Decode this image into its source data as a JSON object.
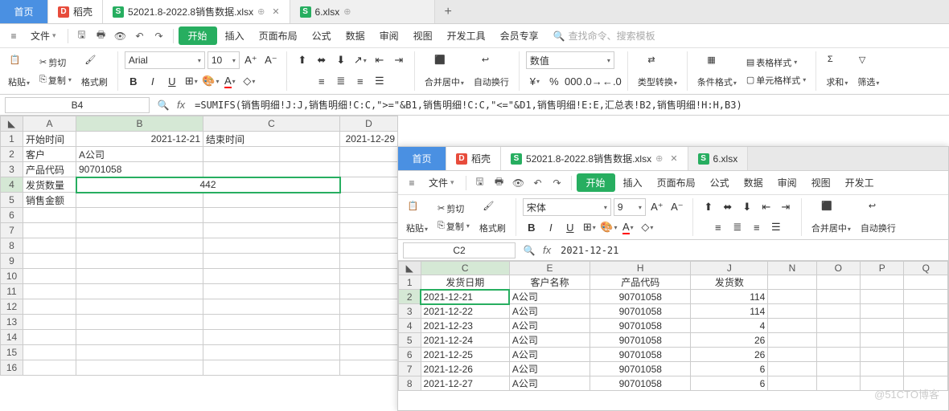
{
  "tabs": {
    "home": "首页",
    "dao": "稻壳",
    "file1": "52021.8-2022.8销售数据.xlsx",
    "file2": "6.xlsx"
  },
  "menu": {
    "file": "文件",
    "start": "开始",
    "insert": "插入",
    "layout": "页面布局",
    "formula": "公式",
    "data": "数据",
    "review": "审阅",
    "view": "视图",
    "dev": "开发工具",
    "member": "会员专享",
    "search_placeholder": "查找命令、搜索模板"
  },
  "ribbon": {
    "paste": "粘贴",
    "cut": "剪切",
    "copy": "复制",
    "format_painter": "格式刷",
    "font_arial": "Arial",
    "font_song": "宋体",
    "font_size_10": "10",
    "font_size_9": "9",
    "merge_center": "合并居中",
    "auto_wrap": "自动换行",
    "number_format": "数值",
    "type_convert": "类型转换",
    "cond_format": "条件格式",
    "table_style": "表格样式",
    "cell_style": "单元格样式",
    "sum": "求和",
    "filter": "筛选"
  },
  "left_sheet": {
    "namebox": "B4",
    "formula": "=SUMIFS(销售明细!J:J,销售明细!C:C,\">=\"&B1,销售明细!C:C,\"<=\"&D1,销售明细!E:E,汇总表!B2,销售明细!H:H,B3)",
    "cols": [
      "A",
      "B",
      "C",
      "D"
    ],
    "cells": {
      "A1": "开始时间",
      "B1": "2021-12-21",
      "C1": "结束时间",
      "D1": "2021-12-29",
      "A2": "客户",
      "B2": "A公司",
      "A3": "产品代码",
      "B3": "90701058",
      "A4": "发货数量",
      "B4": "442",
      "A5": "销售金额"
    }
  },
  "right_sheet": {
    "namebox": "C2",
    "formula": "2021-12-21",
    "cols": [
      "C",
      "E",
      "H",
      "J",
      "N",
      "O",
      "P",
      "Q"
    ],
    "headers": {
      "C": "发货日期",
      "E": "客户名称",
      "H": "产品代码",
      "J": "发货数"
    },
    "rows": [
      {
        "n": 2,
        "C": "2021-12-21",
        "E": "A公司",
        "H": "90701058",
        "J": "114"
      },
      {
        "n": 3,
        "C": "2021-12-22",
        "E": "A公司",
        "H": "90701058",
        "J": "114"
      },
      {
        "n": 4,
        "C": "2021-12-23",
        "E": "A公司",
        "H": "90701058",
        "J": "4"
      },
      {
        "n": 5,
        "C": "2021-12-24",
        "E": "A公司",
        "H": "90701058",
        "J": "26"
      },
      {
        "n": 6,
        "C": "2021-12-25",
        "E": "A公司",
        "H": "90701058",
        "J": "26"
      },
      {
        "n": 7,
        "C": "2021-12-26",
        "E": "A公司",
        "H": "90701058",
        "J": "6"
      },
      {
        "n": 8,
        "C": "2021-12-27",
        "E": "A公司",
        "H": "90701058",
        "J": "6"
      }
    ]
  },
  "watermark": "@51CTO博客"
}
